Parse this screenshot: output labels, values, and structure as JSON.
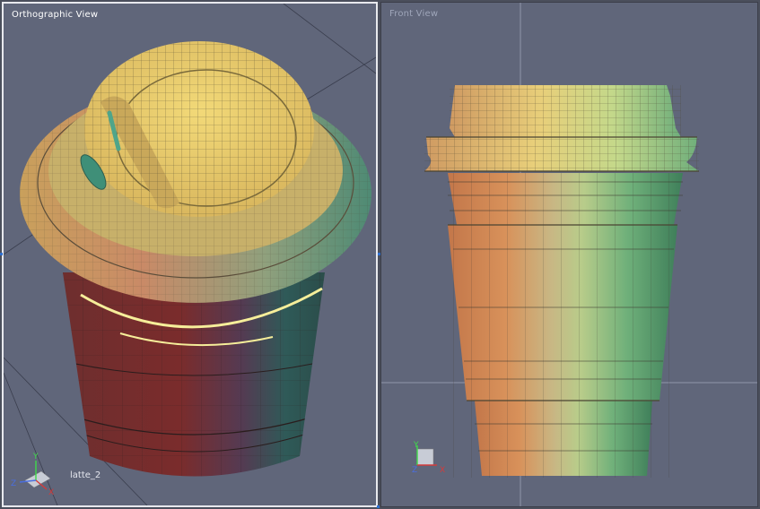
{
  "viewports": {
    "ortho": {
      "title": "Orthographic View",
      "object_label": "latte_2"
    },
    "front": {
      "title": "Front View"
    }
  },
  "axes": {
    "x": "X",
    "y": "Y",
    "z": "Z"
  },
  "colors": {
    "viewport_bg": "#60667a",
    "lid_yellow": "#e9cf6f",
    "wire": "#3c3b33",
    "axis_x": "#d43b3b",
    "axis_y": "#3fd84a",
    "axis_z": "#4a6ee0",
    "selection": "#f6ee9a"
  }
}
